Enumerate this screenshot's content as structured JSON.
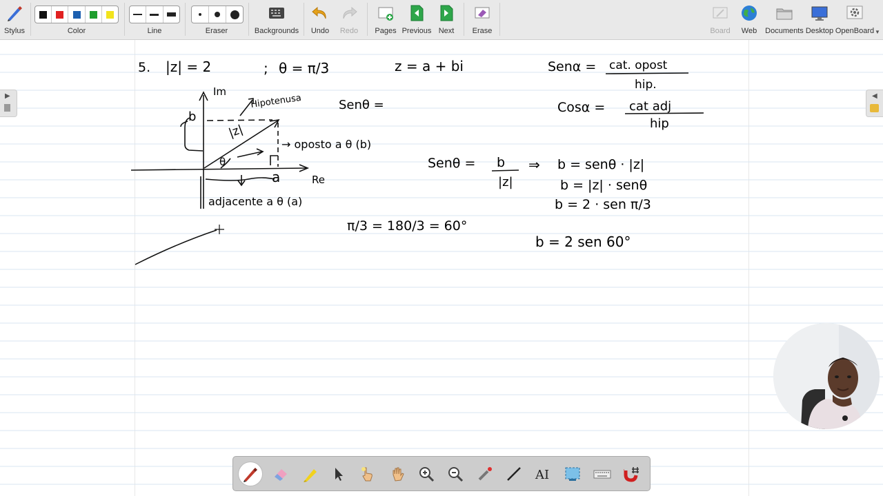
{
  "toolbar": {
    "stylus": "Stylus",
    "color": "Color",
    "line": "Line",
    "eraser": "Eraser",
    "backgrounds": "Backgrounds",
    "undo": "Undo",
    "redo": "Redo",
    "pages": "Pages",
    "previous": "Previous",
    "next": "Next",
    "erase": "Erase",
    "board": "Board",
    "web": "Web",
    "documents": "Documents",
    "desktop": "Desktop",
    "openboard": "OpenBoard"
  },
  "colors": {
    "palette": [
      "#111111",
      "#e02020",
      "#1c5fb0",
      "#1e9e2e",
      "#f2e31c"
    ],
    "accent": "#3a6fd8"
  },
  "board": {
    "problem_number": "5.",
    "modulus": "|z| = 2",
    "semicolon": ";",
    "theta_value": "θ = π/3",
    "z_form": "z = a + bi",
    "sen_def_left": "Senα =",
    "sen_def_num": "cat. opost",
    "sen_def_den": "hip.",
    "cos_def_left": "Cosα =",
    "cos_def_num": "cat adj",
    "cos_def_den": "hip",
    "axis_im": "Im",
    "axis_re": "Re",
    "hipotenusa": "Hipotenusa",
    "label_b": "b",
    "label_z": "|z|",
    "label_theta": "θ",
    "label_a": "a",
    "oposto": "→ oposto a θ (b)",
    "adjacente": "adjacente a θ (a)",
    "sen_theta_blank": "Senθ =",
    "sen_theta_eq": "Senθ =",
    "frac_b": "b",
    "frac_z": "|z|",
    "implies": "⇒",
    "b_eq1": "b = senθ · |z|",
    "b_eq2": "b = |z| · senθ",
    "b_eq3": "b = 2 · sen π/3",
    "pi_conv": "π/3 = 180/3 = 60°",
    "b_eq4": "b = 2 sen 60°"
  }
}
